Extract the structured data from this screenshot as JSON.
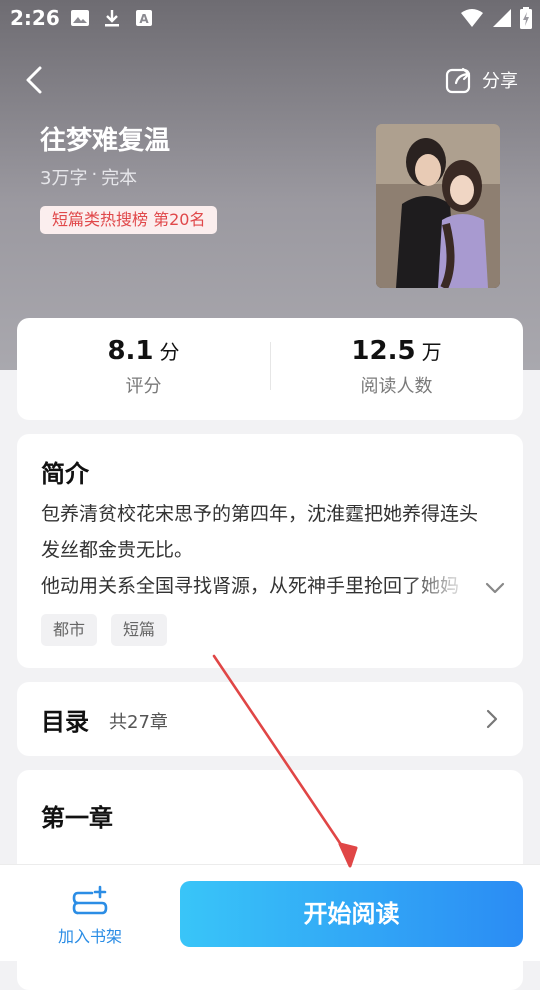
{
  "status_bar": {
    "time": "2:26"
  },
  "header": {
    "share_label": "分享"
  },
  "book": {
    "title": "往梦难复温",
    "word_count": "3万字",
    "separator": "·",
    "status": "完本",
    "rank_badge": "短篇类热搜榜  第20名"
  },
  "stats": [
    {
      "value": "8.1",
      "unit": "分",
      "label": "评分"
    },
    {
      "value": "12.5",
      "unit": "万",
      "label": "阅读人数"
    }
  ],
  "intro": {
    "heading": "简介",
    "lines": [
      "包养清贫校花宋思予的第四年，沈淮霆把她养得连头",
      "发丝都金贵无比。",
      "他动用关系全国寻找肾源，从死神手里抢回了她妈"
    ],
    "tags": [
      "都市",
      "短篇"
    ]
  },
  "toc": {
    "heading": "目录",
    "count": "共27章"
  },
  "chapter": {
    "heading": "第一章"
  },
  "bottom": {
    "shelf_label": "加入书架",
    "read_label": "开始阅读"
  },
  "colors": {
    "accent": "#2b8de5",
    "badge_text": "#e0484a",
    "arrow": "#e04646"
  },
  "icons": [
    "image-icon",
    "download-icon",
    "font-icon",
    "wifi-icon",
    "signal-icon",
    "battery-icon",
    "back-arrow-icon",
    "share-icon",
    "chevron-down-icon",
    "chevron-right-icon",
    "bookshelf-icon"
  ]
}
